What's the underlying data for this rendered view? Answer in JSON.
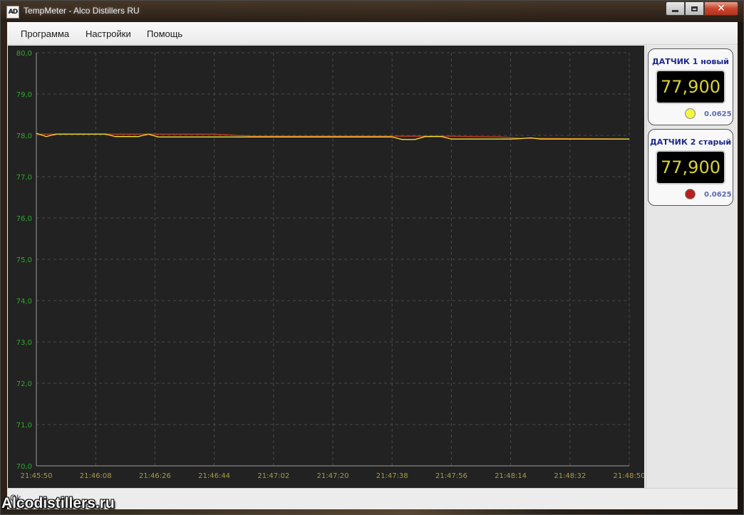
{
  "window": {
    "title": "TempMeter - Alco Distillers RU",
    "icon_text": "AD",
    "icon": "app-logo-icon"
  },
  "menu": {
    "items": [
      {
        "label": "Программа"
      },
      {
        "label": "Настройки"
      },
      {
        "label": "Помощь"
      }
    ]
  },
  "sensors": [
    {
      "title": "ДАТЧИК 1 новый",
      "value": "77,900",
      "color": "#f5f542",
      "step": "0.0625"
    },
    {
      "title": "ДАТЧИК 2 старый",
      "value": "77,900",
      "color": "#b52020",
      "step": "0.0625"
    }
  ],
  "status": {
    "text": "Ok"
  },
  "watermark": "Alcodistillers.ru",
  "colors": {
    "chart_background": "#222222",
    "y_tick_color": "#2fa82f",
    "x_tick_color": "#a89a4a",
    "grid_color": "#4a4a4a",
    "series1": "#f0e030",
    "series2": "#c83c1e"
  },
  "chart_data": {
    "type": "line",
    "title": "",
    "xlabel": "",
    "ylabel": "",
    "ylim": [
      70.0,
      80.0
    ],
    "grid": true,
    "y_ticks": [
      "70,0",
      "71,0",
      "72,0",
      "73,0",
      "74,0",
      "75,0",
      "76,0",
      "77,0",
      "78,0",
      "79,0",
      "80,0"
    ],
    "x_ticks": [
      "21:45:50",
      "21:46:08",
      "21:46:26",
      "21:46:44",
      "21:47:02",
      "21:47:20",
      "21:47:38",
      "21:47:56",
      "21:48:14",
      "21:48:32",
      "21:48:50"
    ],
    "xlim": [
      "21:45:50",
      "21:48:50"
    ],
    "series": [
      {
        "color": "#f0e030",
        "points": [
          [
            "21:45:50",
            78.05
          ],
          [
            "21:45:53",
            77.97
          ],
          [
            "21:45:56",
            78.03
          ],
          [
            "21:46:03",
            78.03
          ],
          [
            "21:46:11",
            78.03
          ],
          [
            "21:46:14",
            77.97
          ],
          [
            "21:46:21",
            77.97
          ],
          [
            "21:46:24",
            78.03
          ],
          [
            "21:46:27",
            77.96
          ],
          [
            "21:46:44",
            77.96
          ],
          [
            "21:46:56",
            77.96
          ],
          [
            "21:47:38",
            77.96
          ],
          [
            "21:47:41",
            77.9
          ],
          [
            "21:47:45",
            77.9
          ],
          [
            "21:47:48",
            77.97
          ],
          [
            "21:47:53",
            77.97
          ],
          [
            "21:47:56",
            77.91
          ],
          [
            "21:48:14",
            77.91
          ],
          [
            "21:48:17",
            77.92
          ],
          [
            "21:48:20",
            77.94
          ],
          [
            "21:48:23",
            77.91
          ],
          [
            "21:48:50",
            77.91
          ]
        ]
      },
      {
        "color": "#c83c1e",
        "points": [
          [
            "21:45:50",
            78.03
          ],
          [
            "21:46:26",
            78.03
          ],
          [
            "21:46:44",
            78.03
          ],
          [
            "21:46:56",
            77.98
          ],
          [
            "21:47:38",
            77.98
          ],
          [
            "21:47:56",
            77.98
          ],
          [
            "21:48:11",
            77.96
          ],
          [
            "21:48:17",
            77.93
          ],
          [
            "21:48:50",
            77.91
          ]
        ]
      }
    ]
  }
}
